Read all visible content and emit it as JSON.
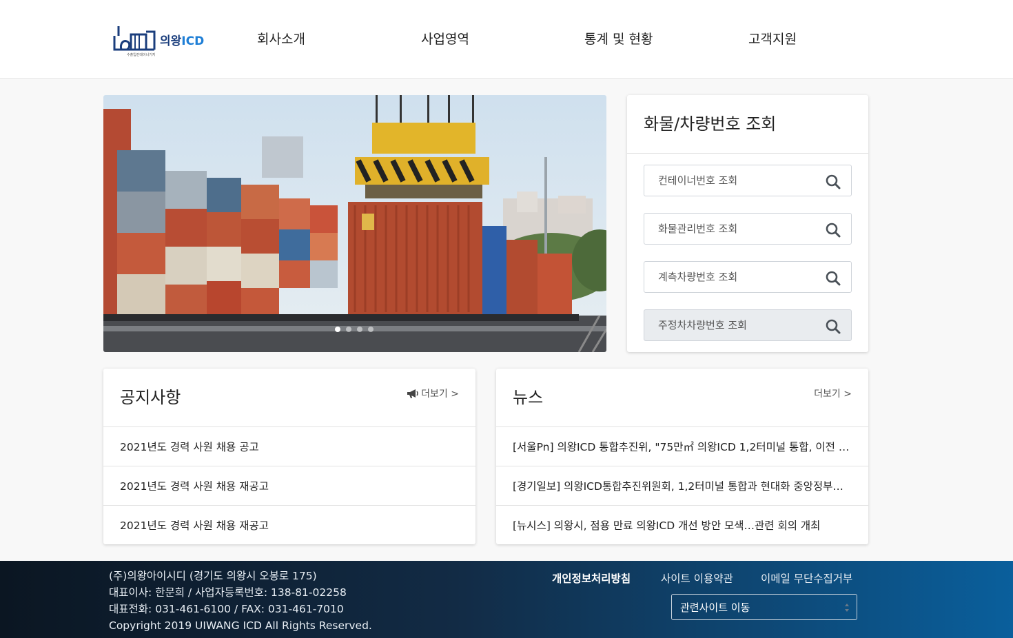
{
  "header": {
    "logo_text_ko": "의왕",
    "logo_text_en": "ICD",
    "logo_sub": "수출입컨테이너기지",
    "nav": [
      "회사소개",
      "사업영역",
      "통계 및 현황",
      "고객지원"
    ]
  },
  "hero": {
    "slide_count": 4,
    "active_slide": 0
  },
  "lookup": {
    "title": "화물/차량번호 조회",
    "fields": [
      {
        "placeholder": "컨테이너번호 조회"
      },
      {
        "placeholder": "화물관리번호 조회"
      },
      {
        "placeholder": "계측차량번호 조회"
      },
      {
        "placeholder": "주정차차량번호 조회"
      }
    ]
  },
  "notice": {
    "title": "공지사항",
    "more": "더보기 >",
    "items": [
      "2021년도 경력 사원 채용 공고",
      "2021년도 경력 사원 채용 재공고",
      "2021년도 경력 사원 채용 재공고"
    ]
  },
  "news": {
    "title": "뉴스",
    "more": "더보기 >",
    "items": [
      "[서울Pn] 의왕ICD 통합추진위, \"75만㎡ 의왕ICD 1,2터미널 통합, 이전 부지 활용 방안\"",
      "[경기일보] 의왕ICD통합추진위원회, 1,2터미널 통합과 현대화 중앙정부에 건의",
      "[뉴시스] 의왕시, 점용 만료 의왕ICD 개선 방안 모색…관련 회의 개최"
    ]
  },
  "footer": {
    "company": "(주)의왕아이시디 (경기도 의왕시 오봉로 175)",
    "ceo": "대표이사: 한문희 / 사업자등록번호: 138-81-02258",
    "phone": "대표전화: 031-461-6100 / FAX: 031-461-7010",
    "copyright": "Copyright 2019 UIWANG ICD All Rights Reserved.",
    "links": [
      "개인정보처리방침",
      "사이트 이용약관",
      "이메일 무단수집거부"
    ],
    "site_select": "관련사이트 이동"
  },
  "colors": {
    "footer_start": "#0b1622",
    "footer_end": "#0a5f9c",
    "logo_navy": "#1a3d7c",
    "logo_blue": "#1f7fd6"
  }
}
